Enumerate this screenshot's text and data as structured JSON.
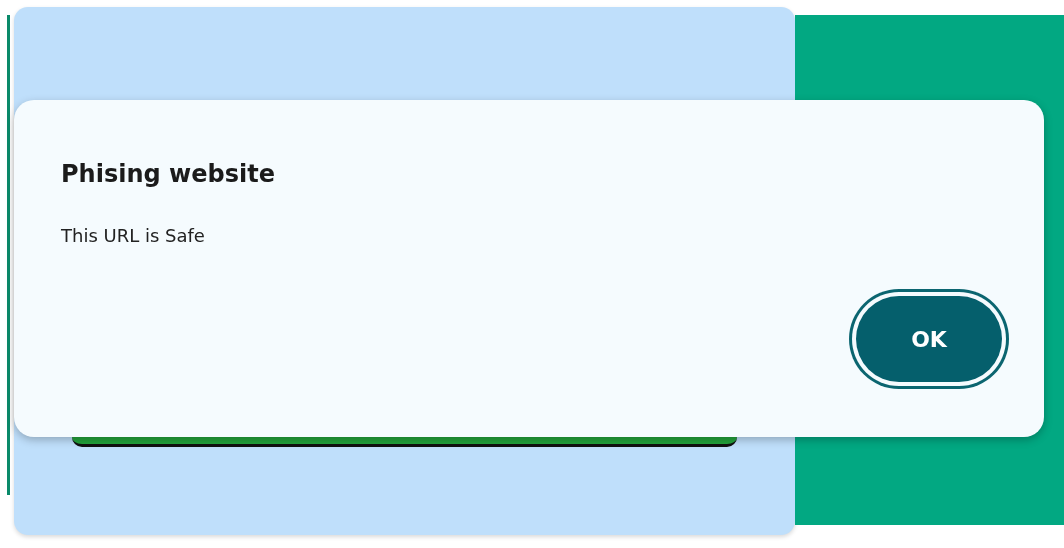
{
  "dialog": {
    "title": "Phising website",
    "message": "This URL is Safe",
    "buttons": [
      "OK"
    ]
  }
}
